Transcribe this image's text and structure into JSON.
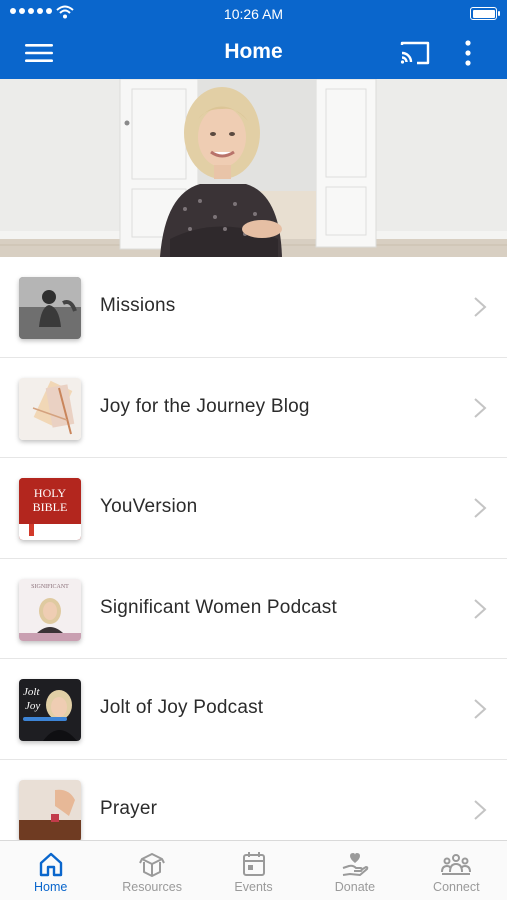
{
  "status_bar": {
    "time": "10:26 AM"
  },
  "header": {
    "title": "Home"
  },
  "menu_items": [
    {
      "label": "Missions"
    },
    {
      "label": "Joy for the Journey Blog"
    },
    {
      "label": "YouVersion",
      "thumb_text_line1": "HOLY",
      "thumb_text_line2": "BIBLE"
    },
    {
      "label": "Significant Women Podcast",
      "thumb_text": "SIGNIFICANT"
    },
    {
      "label": "Jolt of Joy Podcast",
      "thumb_text_line1": "Jolt",
      "thumb_text_line2": "Joy"
    },
    {
      "label": "Prayer"
    }
  ],
  "tabs": [
    {
      "label": "Home",
      "icon": "home-icon",
      "active": true
    },
    {
      "label": "Resources",
      "icon": "box-icon",
      "active": false
    },
    {
      "label": "Events",
      "icon": "calendar-icon",
      "active": false
    },
    {
      "label": "Donate",
      "icon": "donate-hand-icon",
      "active": false
    },
    {
      "label": "Connect",
      "icon": "people-icon",
      "active": false
    }
  ],
  "colors": {
    "brand": "#0a66cc",
    "tab_inactive": "#9a9a9a",
    "divider": "#e6e6e6"
  }
}
